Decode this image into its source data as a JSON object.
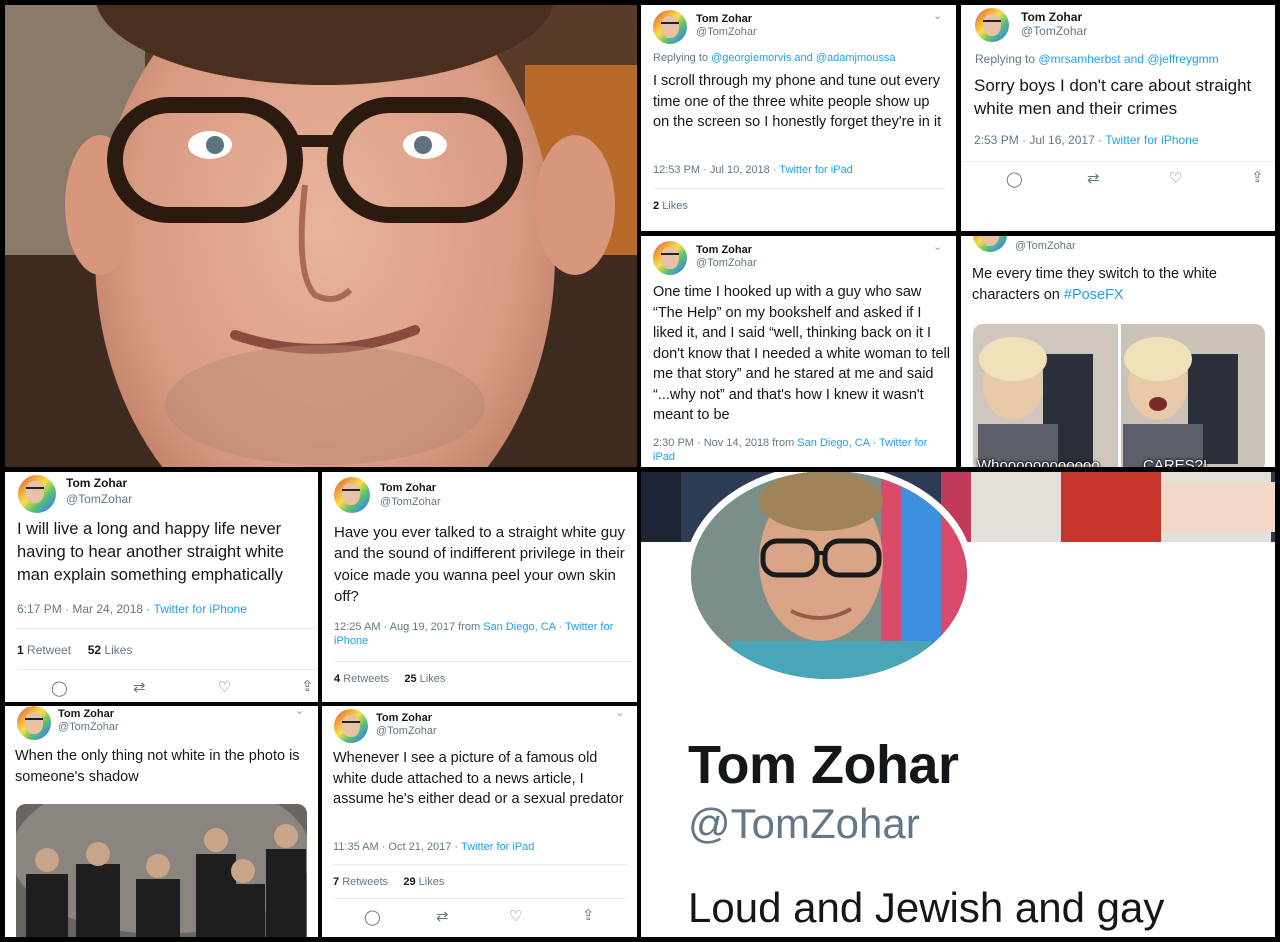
{
  "user": {
    "name": "Tom Zohar",
    "handle": "@TomZohar"
  },
  "tweets": {
    "t1": {
      "reply_prefix": "Replying to",
      "reply_a": "@georgiemorvis",
      "reply_and": "and",
      "reply_b": "@adamjmoussa",
      "text": "I scroll through my phone and tune out every time one of the three white people show up on the screen so I honestly forget they're in it",
      "time": "12:53 PM · Jul 10, 2018 ·",
      "source": "Twitter for iPad",
      "likes_n": "2",
      "likes_l": "Likes"
    },
    "t2": {
      "reply_prefix": "Replying to",
      "reply_a": "@mrsamherbst",
      "reply_and": "and",
      "reply_b": "@jeffreygmm",
      "text": "Sorry boys I don't care about straight white men and their crimes",
      "time": "2:53 PM · Jul 16, 2017 ·",
      "source": "Twitter for iPhone"
    },
    "t3": {
      "text": "One time I hooked up with a guy who saw “The Help” on my bookshelf and asked if I liked it, and I said “well, thinking back on it I don't know that I needed a white woman to tell me that story” and he stared at me and said “...why not” and that's how I knew it wasn't meant to be",
      "time": "2:30 PM · Nov 14, 2018 from",
      "location": "San Diego, CA",
      "sep": "·",
      "source": "Twitter for iPad"
    },
    "t4": {
      "text": "Me every time they switch to the white characters on",
      "hashtag": "#PoseFX",
      "caption_left": "Whoooooooooooo",
      "caption_right": "CARES?!"
    },
    "t5": {
      "text": "I will live a long and happy life never having to hear another straight white man explain something emphatically",
      "time": "6:17 PM · Mar 24, 2018 ·",
      "source": "Twitter for iPhone",
      "retweets_n": "1",
      "retweets_l": "Retweet",
      "likes_n": "52",
      "likes_l": "Likes"
    },
    "t6": {
      "text": "Have you ever talked to a straight white guy and the sound of indifferent privilege in their voice made you wanna peel your own skin off?",
      "time": "12:25 AM · Aug 19, 2017 from",
      "location": "San Diego, CA",
      "sep": "·",
      "source": "Twitter for iPhone",
      "retweets_n": "4",
      "retweets_l": "Retweets",
      "likes_n": "25",
      "likes_l": "Likes"
    },
    "t7": {
      "text": "When the only thing not white in the photo is someone's shadow"
    },
    "t8": {
      "text": "Whenever I see a picture of a famous old white dude attached to a news article, I assume he's either dead or a sexual predator",
      "time": "11:35 AM · Oct 21, 2017 ·",
      "source": "Twitter for iPad",
      "retweets_n": "7",
      "retweets_l": "Retweets",
      "likes_n": "29",
      "likes_l": "Likes"
    }
  },
  "profile": {
    "name": "Tom Zohar",
    "handle": "@TomZohar",
    "bio": "Loud and Jewish and gay"
  },
  "icons": {
    "reply": "reply-icon",
    "retweet": "retweet-icon",
    "like": "like-icon",
    "share": "share-icon",
    "chevron": "chevron-down-icon"
  },
  "colors": {
    "link": "#1da1f2",
    "text": "#14171a",
    "muted": "#657786"
  }
}
